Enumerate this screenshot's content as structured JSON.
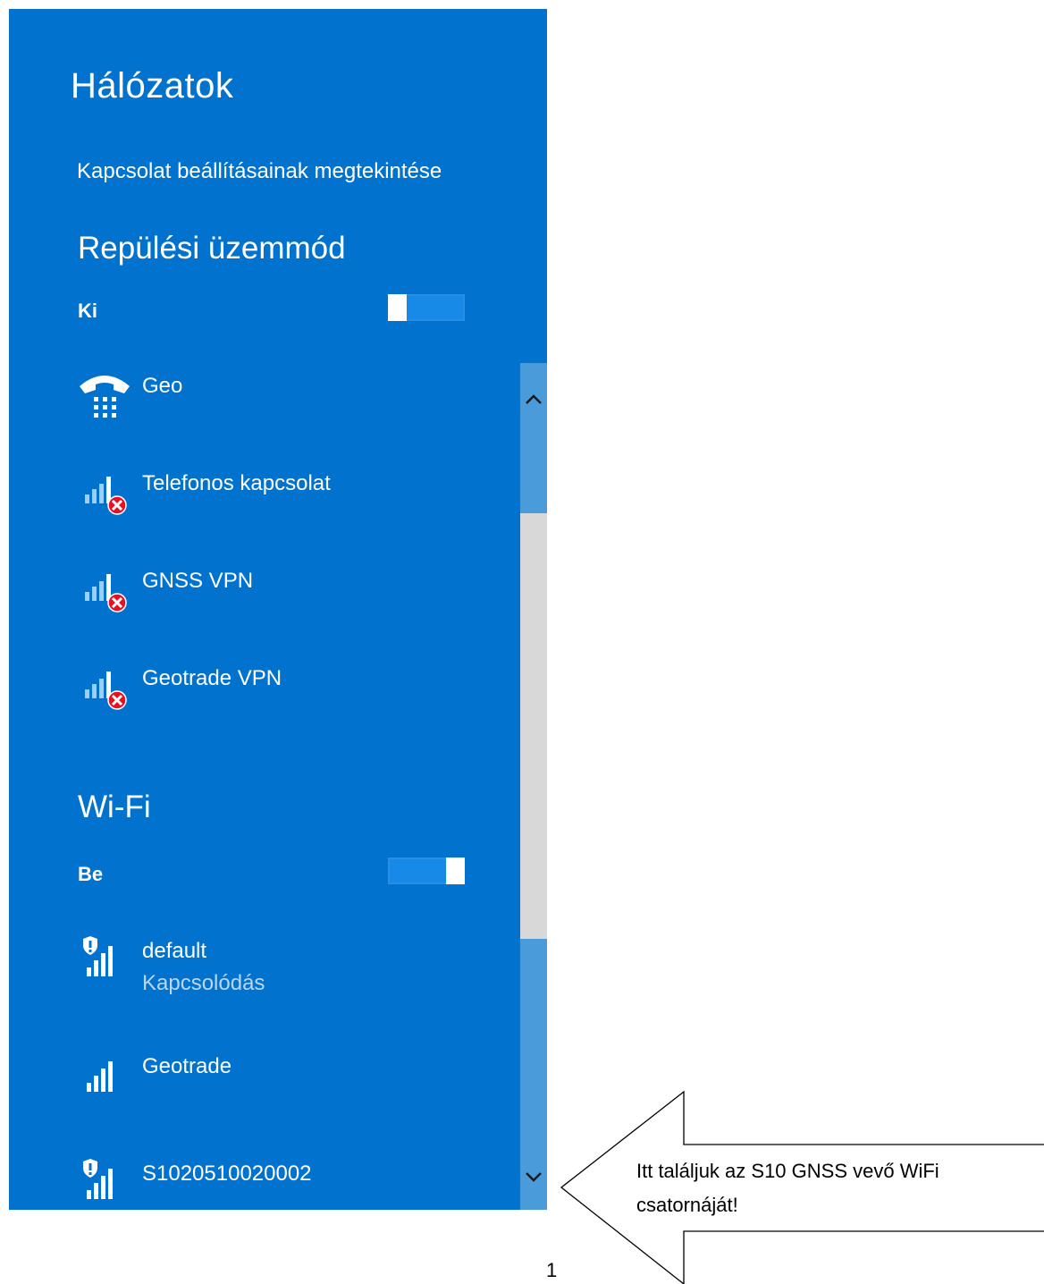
{
  "panel": {
    "title": "Hálózatok",
    "settings_link": "Kapcsolat beállításainak megtekintése",
    "airplane": {
      "title": "Repülési üzemmód",
      "state": "Ki",
      "on": false
    },
    "connections": [
      {
        "name": "Geo",
        "icon": "dialup-phone-icon"
      },
      {
        "name": "Telefonos kapcsolat",
        "icon": "signal-disconnected-icon"
      },
      {
        "name": "GNSS VPN",
        "icon": "signal-disconnected-icon"
      },
      {
        "name": "Geotrade VPN",
        "icon": "signal-disconnected-icon"
      }
    ],
    "wifi": {
      "title": "Wi-Fi",
      "state": "Be",
      "on": true,
      "networks": [
        {
          "name": "default",
          "status": "Kapcsolódás",
          "secured_warning": true
        },
        {
          "name": "Geotrade",
          "status": "",
          "secured_warning": false
        },
        {
          "name": "S1020510020002",
          "status": "",
          "secured_warning": true
        }
      ]
    }
  },
  "callout": {
    "text": "Itt találjuk az S10 GNSS vevő WiFi csatornáját!"
  },
  "page_number": "1",
  "colors": {
    "panel": "#0173cf",
    "toggle_track": "#178ae8",
    "error_badge": "#e81123",
    "scrollbar": "#4a9bd9"
  }
}
